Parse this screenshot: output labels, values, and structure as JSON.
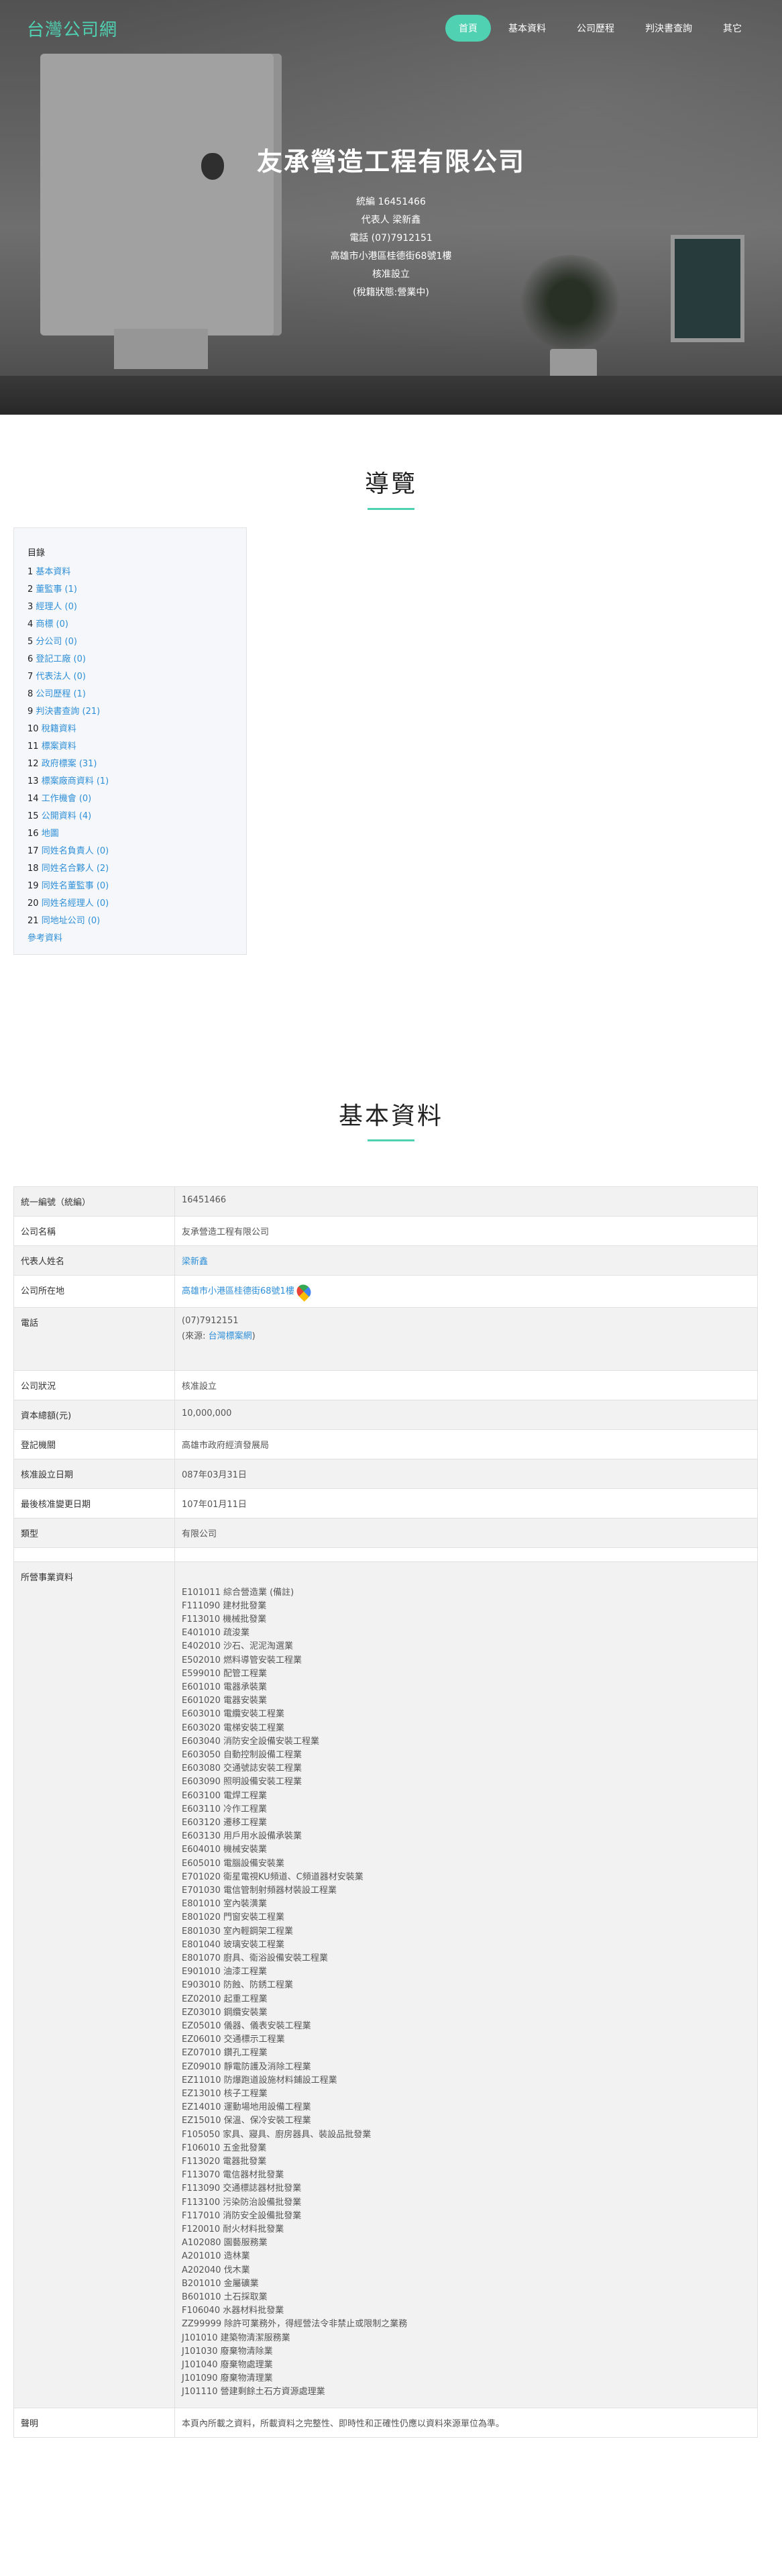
{
  "nav": {
    "brand": "台灣公司網",
    "items": [
      {
        "label": "首頁",
        "active": true
      },
      {
        "label": "基本資料",
        "active": false
      },
      {
        "label": "公司歷程",
        "active": false
      },
      {
        "label": "判決書查詢",
        "active": false
      },
      {
        "label": "其它",
        "active": false
      }
    ]
  },
  "hero": {
    "title": "友承營造工程有限公司",
    "lines": [
      "統編 16451466",
      "代表人 梁新鑫",
      "電話 (07)7912151",
      "高雄市小港區桂德街68號1樓",
      "核准設立",
      "(稅籍狀態:營業中)"
    ]
  },
  "toc": {
    "section_title": "導覽",
    "heading": "目錄",
    "items": [
      {
        "num": "1",
        "label": "基本資料"
      },
      {
        "num": "2",
        "label": "董監事 (1)"
      },
      {
        "num": "3",
        "label": "經理人 (0)"
      },
      {
        "num": "4",
        "label": "商標 (0)"
      },
      {
        "num": "5",
        "label": "分公司 (0)"
      },
      {
        "num": "6",
        "label": "登記工廠 (0)"
      },
      {
        "num": "7",
        "label": "代表法人 (0)"
      },
      {
        "num": "8",
        "label": "公司歷程 (1)"
      },
      {
        "num": "9",
        "label": "判決書查詢 (21)"
      },
      {
        "num": "10",
        "label": "稅籍資料"
      },
      {
        "num": "11",
        "label": "標案資料"
      },
      {
        "num": "12",
        "label": "政府標案 (31)"
      },
      {
        "num": "13",
        "label": "標案廠商資料 (1)"
      },
      {
        "num": "14",
        "label": "工作機會 (0)"
      },
      {
        "num": "15",
        "label": "公開資料 (4)"
      },
      {
        "num": "16",
        "label": "地圖"
      },
      {
        "num": "17",
        "label": "同姓名負責人 (0)"
      },
      {
        "num": "18",
        "label": "同姓名合夥人 (2)"
      },
      {
        "num": "19",
        "label": "同姓名董監事 (0)"
      },
      {
        "num": "20",
        "label": "同姓名經理人 (0)"
      },
      {
        "num": "21",
        "label": "同地址公司 (0)"
      }
    ],
    "footer_link": "參考資料"
  },
  "basic": {
    "section_title": "基本資料",
    "rows": [
      {
        "key": "統一編號（統編）",
        "value": "16451466"
      },
      {
        "key": "公司名稱",
        "value": "友承營造工程有限公司"
      },
      {
        "key": "代表人姓名",
        "value": "梁新鑫"
      },
      {
        "key": "公司所在地",
        "value": "高雄市小港區桂德街68號1樓"
      },
      {
        "key": "電話",
        "value": "(07)7912151",
        "source_prefix": "(來源: ",
        "source_link": "台灣標案網",
        "source_suffix": ")"
      },
      {
        "key": "公司狀況",
        "value": "核准設立"
      },
      {
        "key": "資本總額(元)",
        "value": "10,000,000"
      },
      {
        "key": "登記機關",
        "value": "高雄市政府經濟發展局"
      },
      {
        "key": "核准設立日期",
        "value": "087年03月31日"
      },
      {
        "key": "最後核准變更日期",
        "value": "107年01月11日"
      },
      {
        "key": "類型",
        "value": "有限公司"
      },
      {
        "key": "",
        "value": ""
      },
      {
        "key": "所營事業資料",
        "value": ""
      },
      {
        "key": "聲明",
        "value": "本頁內所載之資料，所載資料之完整性、即時性和正確性仍應以資料來源單位為準。"
      }
    ],
    "business_items": [
      "E101011 綜合營造業 (備註)",
      "F111090 建材批發業",
      "F113010 機械批發業",
      "E401010 疏浚業",
      "E402010 沙石、泥泥淘選業",
      "E502010 燃料導管安裝工程業",
      "E599010 配管工程業",
      "E601010 電器承裝業",
      "E601020 電器安裝業",
      "E603010 電纜安裝工程業",
      "E603020 電梯安裝工程業",
      "E603040 消防安全設備安裝工程業",
      "E603050 自動控制設備工程業",
      "E603080 交通號誌安裝工程業",
      "E603090 照明設備安裝工程業",
      "E603100 電焊工程業",
      "E603110 冷作工程業",
      "E603120 遷移工程業",
      "E603130 用戶用水設備承裝業",
      "E604010 機械安裝業",
      "E605010 電腦設備安裝業",
      "E701020 衛星電視KU頻道、C頻道器材安裝業",
      "E701030 電信管制射頻器材裝設工程業",
      "E801010 室內裝潢業",
      "E801020 門窗安裝工程業",
      "E801030 室內輕鋼架工程業",
      "E801040 玻璃安裝工程業",
      "E801070 廚具、衛浴設備安裝工程業",
      "E901010 油漆工程業",
      "E903010 防蝕、防銹工程業",
      "EZ02010 起重工程業",
      "EZ03010 鋼纜安裝業",
      "EZ05010 儀器、儀表安裝工程業",
      "EZ06010 交通標示工程業",
      "EZ07010 鑽孔工程業",
      "EZ09010 靜電防護及消除工程業",
      "EZ11010 防爆跑道設施材料鋪設工程業",
      "EZ13010 核子工程業",
      "EZ14010 運動場地用設備工程業",
      "EZ15010 保溫、保冷安裝工程業",
      "F105050 家具、寢具、廚房器具、裝設品批發業",
      "F106010 五金批發業",
      "F113020 電器批發業",
      "F113070 電信器材批發業",
      "F113090 交通標誌器材批發業",
      "F113100 污染防治設備批發業",
      "F117010 消防安全設備批發業",
      "F120010 耐火材料批發業",
      "A102080 園藝服務業",
      "A201010 造林業",
      "A202040 伐木業",
      "B201010 金屬礦業",
      "B601010 土石採取業",
      "F106040 水器材料批發業",
      "ZZ99999 除許可業務外，得經營法令非禁止或限制之業務",
      "J101010 建築物清潔服務業",
      "J101030 廢棄物清除業",
      "J101040 廢棄物處理業",
      "J101090 廢棄物清理業",
      "J101110 營建剩餘土石方資源處理業"
    ]
  }
}
